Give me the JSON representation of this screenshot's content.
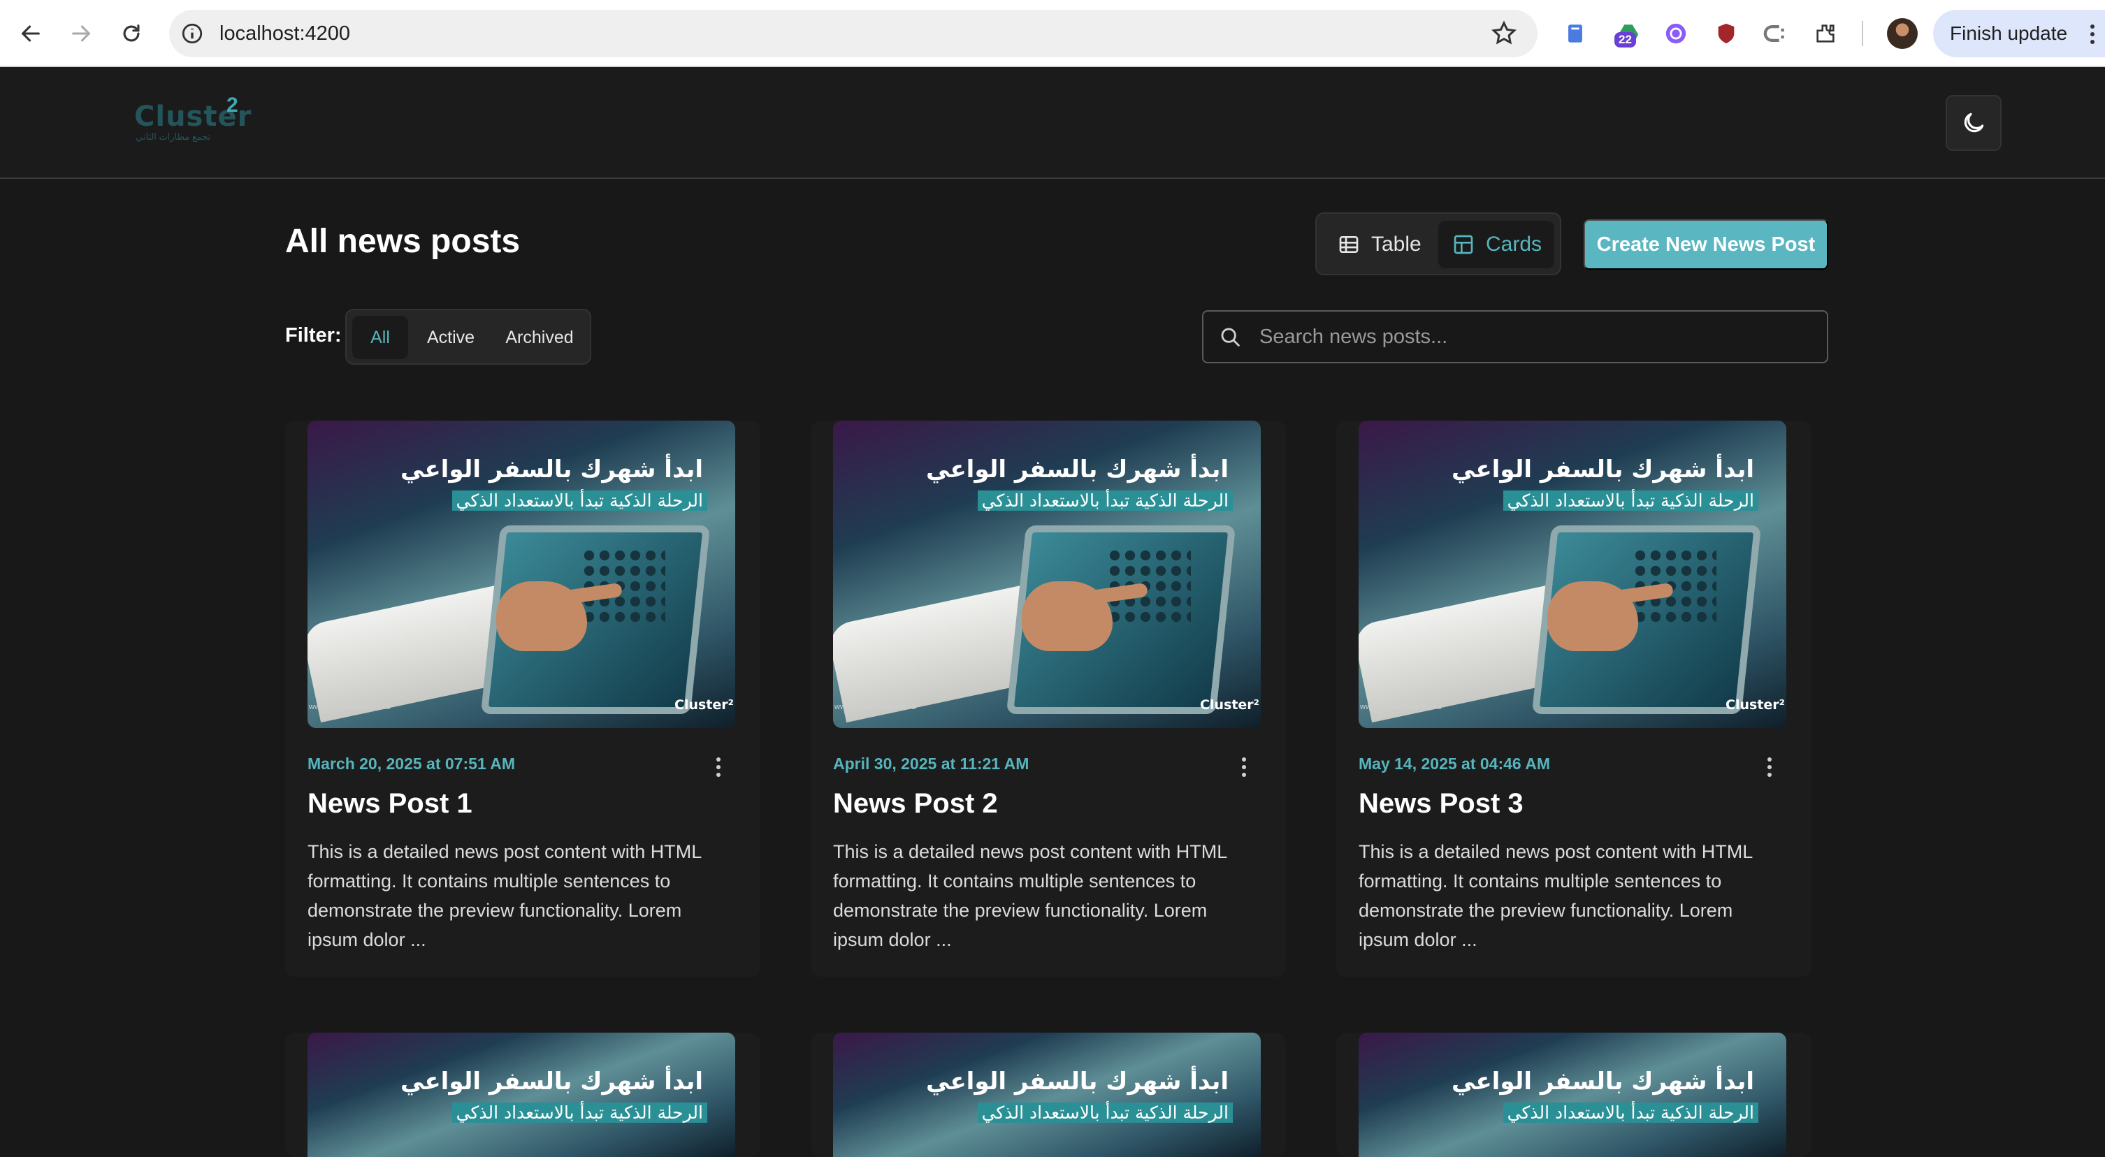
{
  "browser": {
    "url": "localhost:4200",
    "extension_badge": "22",
    "update_label": "Finish update"
  },
  "header": {
    "logo_text": "Cluster",
    "logo_sup": "2",
    "logo_tagline": "تجمع مطارات الثاني"
  },
  "page": {
    "title": "All news posts",
    "view_toggle": {
      "table_label": "Table",
      "cards_label": "Cards",
      "active": "Cards"
    },
    "create_button": "Create New News Post",
    "filter": {
      "label": "Filter:",
      "options": [
        "All",
        "Active",
        "Archived"
      ],
      "active": "All"
    },
    "search_placeholder": "Search news posts..."
  },
  "colors": {
    "accent": "#56b5bd",
    "button": "#5ab6c0",
    "background": "#181818"
  },
  "card_image": {
    "headline_ar": "ابدأ شهرك بالسفر الواعي",
    "subline_ar": "الرحلة الذكية تبدأ بالاستعداد الذكي",
    "brand": "Cluster²",
    "footer_text": "www.cluster2airports.sa"
  },
  "posts": [
    {
      "date": "March 20, 2025 at 07:51 AM",
      "title": "News Post 1",
      "excerpt": "This is a detailed news post content with HTML formatting. It contains multiple sentences to demonstrate the preview functionality. Lorem ipsum dolor ..."
    },
    {
      "date": "April 30, 2025 at 11:21 AM",
      "title": "News Post 2",
      "excerpt": "This is a detailed news post content with HTML formatting. It contains multiple sentences to demonstrate the preview functionality. Lorem ipsum dolor ..."
    },
    {
      "date": "May 14, 2025 at 04:46 AM",
      "title": "News Post 3",
      "excerpt": "This is a detailed news post content with HTML formatting. It contains multiple sentences to demonstrate the preview functionality. Lorem ipsum dolor ..."
    }
  ]
}
